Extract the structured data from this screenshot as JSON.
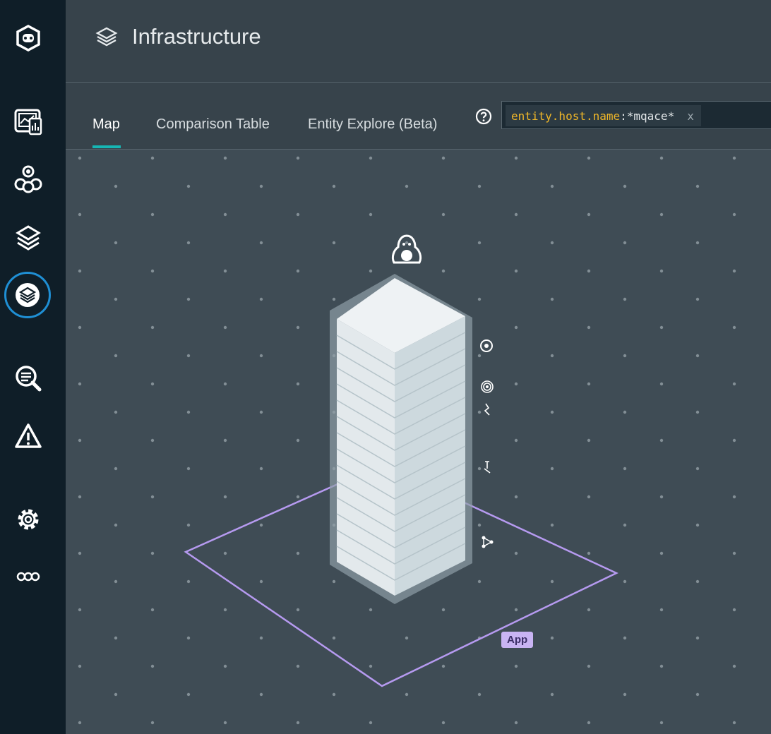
{
  "app": {
    "title": "Infrastructure",
    "title_icon": "layers-icon"
  },
  "sidebar": {
    "items": [
      {
        "name": "logo",
        "icon": "robot-logo-icon"
      },
      {
        "name": "dashboards",
        "icon": "dashboard-icon"
      },
      {
        "name": "services",
        "icon": "services-icon"
      },
      {
        "name": "application",
        "icon": "application-icon"
      },
      {
        "name": "infrastructure",
        "icon": "layers-icon",
        "active": true
      },
      {
        "name": "analytics",
        "icon": "search-analytics-icon"
      },
      {
        "name": "events",
        "icon": "warning-icon"
      },
      {
        "name": "settings",
        "icon": "gear-icon"
      },
      {
        "name": "more",
        "icon": "more-icon"
      }
    ]
  },
  "tabs": [
    {
      "label": "Map",
      "active": true
    },
    {
      "label": "Comparison Table",
      "active": false
    },
    {
      "label": "Entity Explore (Beta)",
      "active": false
    }
  ],
  "filter": {
    "key": "entity.host.name",
    "separator": ":",
    "value": "*mqace*",
    "remove": "x"
  },
  "map": {
    "group_label": "App",
    "host_os_icon": "linux-penguin-icon",
    "side_icons": [
      "grafana-icon",
      "signal-icon",
      "python-icon",
      "python-icon",
      "graph-icon"
    ],
    "colors": {
      "background": "#3f4c55",
      "zone_outline": "#b69af0",
      "tower_top": "#eef2f4",
      "tower_side": "#cdd9de"
    }
  }
}
